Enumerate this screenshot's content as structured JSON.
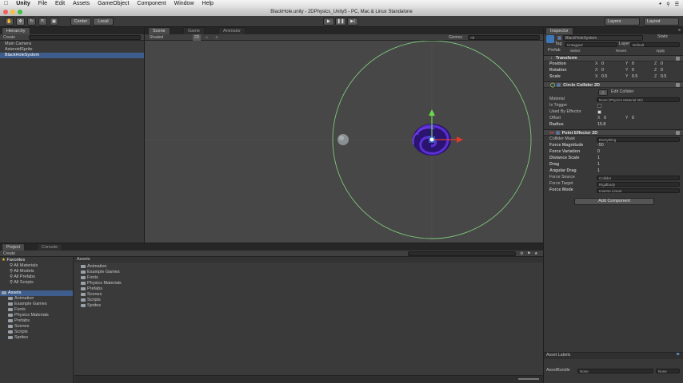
{
  "mac_menu": {
    "app": "Unity",
    "items": [
      "File",
      "Edit",
      "Assets",
      "GameObject",
      "Component",
      "Window",
      "Help"
    ]
  },
  "window_title": "BlackHole.unity - 2DPhysics_Unity5 - PC, Mac & Linux Standalone",
  "toolbar": {
    "pivot_label": "Center",
    "space_label": "Local",
    "layers_label": "Layers",
    "layout_label": "Layout"
  },
  "hierarchy": {
    "tab": "Hierarchy",
    "create": "Create",
    "items": [
      "Main Camera",
      "AsteroidSprite",
      "BlackHoleSystem"
    ],
    "selected_index": 2
  },
  "scene": {
    "tabs": [
      "Scene",
      "Game",
      "Animator"
    ],
    "shading": "Shaded",
    "mode_2d": "2D",
    "gizmos": "Gizmos",
    "search_all": "All"
  },
  "project": {
    "tabs": [
      "Project",
      "Console"
    ],
    "create": "Create",
    "favorites_label": "Favorites",
    "favorites": [
      "All Materials",
      "All Models",
      "All Prefabs",
      "All Scripts"
    ],
    "assets_label": "Assets",
    "tree_folders": [
      "Animation",
      "Example Games",
      "Fonts",
      "Physics Materials",
      "Prefabs",
      "Scenes",
      "Scripts",
      "Sprites"
    ],
    "breadcrumb": "Assets",
    "content_folders": [
      "Animation",
      "Example Games",
      "Fonts",
      "Physics Materials",
      "Prefabs",
      "Scenes",
      "Scripts",
      "Sprites"
    ]
  },
  "inspector": {
    "tab": "Inspector",
    "object_name": "BlackHoleSystem",
    "static_label": "Static",
    "tag_label": "Tag",
    "tag_value": "Untagged",
    "layer_label": "Layer",
    "layer_value": "Default",
    "prefab_label": "Prefab",
    "prefab_select": "Select",
    "prefab_revert": "Revert",
    "prefab_apply": "Apply",
    "transform": {
      "title": "Transform",
      "position_label": "Position",
      "rotation_label": "Rotation",
      "scale_label": "Scale",
      "position": [
        "0",
        "0",
        "0"
      ],
      "rotation": [
        "0",
        "0",
        "0"
      ],
      "scale": [
        "0.5",
        "0.5",
        "0.5"
      ]
    },
    "circle_collider": {
      "title": "Circle Collider 2D",
      "edit_label": "Edit Collider",
      "material_label": "Material",
      "material_value": "None (Physics Material 2D)",
      "is_trigger_label": "Is Trigger",
      "used_by_effector_label": "Used By Effector",
      "offset_label": "Offset",
      "offset": [
        "0",
        "0"
      ],
      "radius_label": "Radius",
      "radius": "15.8"
    },
    "point_effector": {
      "title": "Point Effector 2D",
      "collider_mask_label": "Collider Mask",
      "collider_mask": "Everything",
      "force_magnitude_label": "Force Magnitude",
      "force_magnitude": "-50",
      "force_variation_label": "Force Variation",
      "force_variation": "0",
      "distance_scale_label": "Distance Scale",
      "distance_scale": "1",
      "drag_label": "Drag",
      "drag": "1",
      "angular_drag_label": "Angular Drag",
      "angular_drag": "1",
      "force_source_label": "Force Source",
      "force_source": "Collider",
      "force_target_label": "Force Target",
      "force_target": "Rigidbody",
      "force_mode_label": "Force Mode",
      "force_mode": "Inverse Linear"
    },
    "add_component": "Add Component",
    "asset_labels": "Asset Labels",
    "asset_bundle_label": "AssetBundle",
    "asset_bundle_value": "None",
    "asset_variant_value": "None"
  },
  "colors": {
    "collider_circle": "#7ec87a",
    "selection": "#3e5d8c",
    "blackhole": "#3a1d9e"
  }
}
